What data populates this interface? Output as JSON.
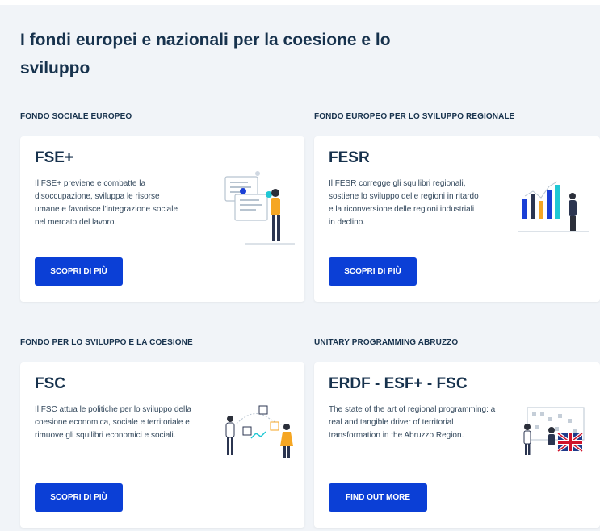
{
  "page_title": "I fondi europei e nazionali per la coesione e lo sviluppo",
  "sections": [
    {
      "label": "FONDO SOCIALE EUROPEO",
      "title": "FSE+",
      "text": "Il FSE+ previene e combatte la disoccupazione, sviluppa le risorse umane e favorisce l'integrazione sociale nel mercato del lavoro.",
      "button": "SCOPRI DI PIÙ",
      "illustration": "person-with-documents-icon"
    },
    {
      "label": "FONDO EUROPEO PER LO SVILUPPO REGIONALE",
      "title": "FESR",
      "text": "Il FESR corregge gli squilibri regionali, sostiene lo sviluppo delle regioni in ritardo e la riconversione delle regioni industriali in declino.",
      "button": "SCOPRI DI PIÙ",
      "illustration": "bar-chart-person-icon"
    },
    {
      "label": "FONDO PER LO SVILUPPO E LA COESIONE",
      "title": "FSC",
      "text": "Il FSC attua le politiche per lo sviluppo della coesione economica, sociale e territoriale e rimuove gli squilibri economici e sociali.",
      "button": "SCOPRI DI PIÙ",
      "illustration": "two-people-network-icon"
    },
    {
      "label": "UNITARY PROGRAMMING ABRUZZO",
      "title": "ERDF - ESF+ - FSC",
      "text": "The state of the art of regional programming: a real and tangible driver of territorial transformation in the Abruzzo Region.",
      "button": "FIND OUT MORE",
      "illustration": "uk-flag-board-icon"
    }
  ],
  "colors": {
    "background": "#f1f4f8",
    "button": "#0b3fd6",
    "text": "#17324d",
    "accent_yellow": "#f5a623",
    "accent_teal": "#1fc7d4"
  }
}
